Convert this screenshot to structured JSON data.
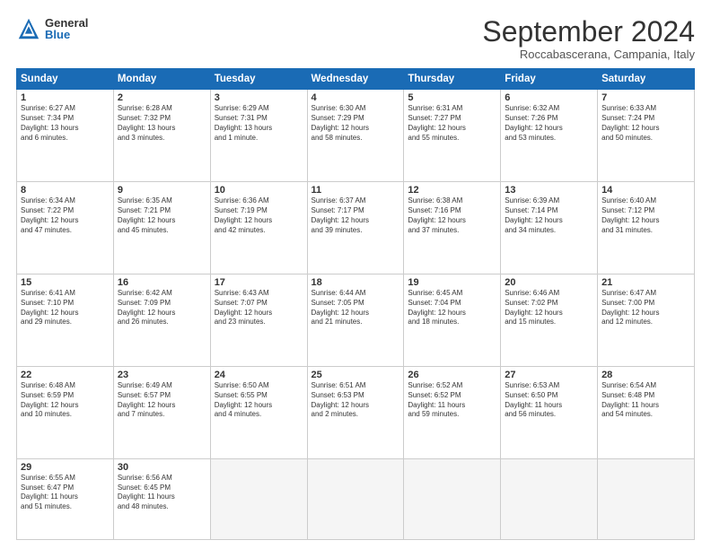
{
  "header": {
    "logo_general": "General",
    "logo_blue": "Blue",
    "month_title": "September 2024",
    "location": "Roccabascerana, Campania, Italy"
  },
  "days_of_week": [
    "Sunday",
    "Monday",
    "Tuesday",
    "Wednesday",
    "Thursday",
    "Friday",
    "Saturday"
  ],
  "weeks": [
    [
      {
        "num": "1",
        "info": "Sunrise: 6:27 AM\nSunset: 7:34 PM\nDaylight: 13 hours\nand 6 minutes."
      },
      {
        "num": "2",
        "info": "Sunrise: 6:28 AM\nSunset: 7:32 PM\nDaylight: 13 hours\nand 3 minutes."
      },
      {
        "num": "3",
        "info": "Sunrise: 6:29 AM\nSunset: 7:31 PM\nDaylight: 13 hours\nand 1 minute."
      },
      {
        "num": "4",
        "info": "Sunrise: 6:30 AM\nSunset: 7:29 PM\nDaylight: 12 hours\nand 58 minutes."
      },
      {
        "num": "5",
        "info": "Sunrise: 6:31 AM\nSunset: 7:27 PM\nDaylight: 12 hours\nand 55 minutes."
      },
      {
        "num": "6",
        "info": "Sunrise: 6:32 AM\nSunset: 7:26 PM\nDaylight: 12 hours\nand 53 minutes."
      },
      {
        "num": "7",
        "info": "Sunrise: 6:33 AM\nSunset: 7:24 PM\nDaylight: 12 hours\nand 50 minutes."
      }
    ],
    [
      {
        "num": "8",
        "info": "Sunrise: 6:34 AM\nSunset: 7:22 PM\nDaylight: 12 hours\nand 47 minutes."
      },
      {
        "num": "9",
        "info": "Sunrise: 6:35 AM\nSunset: 7:21 PM\nDaylight: 12 hours\nand 45 minutes."
      },
      {
        "num": "10",
        "info": "Sunrise: 6:36 AM\nSunset: 7:19 PM\nDaylight: 12 hours\nand 42 minutes."
      },
      {
        "num": "11",
        "info": "Sunrise: 6:37 AM\nSunset: 7:17 PM\nDaylight: 12 hours\nand 39 minutes."
      },
      {
        "num": "12",
        "info": "Sunrise: 6:38 AM\nSunset: 7:16 PM\nDaylight: 12 hours\nand 37 minutes."
      },
      {
        "num": "13",
        "info": "Sunrise: 6:39 AM\nSunset: 7:14 PM\nDaylight: 12 hours\nand 34 minutes."
      },
      {
        "num": "14",
        "info": "Sunrise: 6:40 AM\nSunset: 7:12 PM\nDaylight: 12 hours\nand 31 minutes."
      }
    ],
    [
      {
        "num": "15",
        "info": "Sunrise: 6:41 AM\nSunset: 7:10 PM\nDaylight: 12 hours\nand 29 minutes."
      },
      {
        "num": "16",
        "info": "Sunrise: 6:42 AM\nSunset: 7:09 PM\nDaylight: 12 hours\nand 26 minutes."
      },
      {
        "num": "17",
        "info": "Sunrise: 6:43 AM\nSunset: 7:07 PM\nDaylight: 12 hours\nand 23 minutes."
      },
      {
        "num": "18",
        "info": "Sunrise: 6:44 AM\nSunset: 7:05 PM\nDaylight: 12 hours\nand 21 minutes."
      },
      {
        "num": "19",
        "info": "Sunrise: 6:45 AM\nSunset: 7:04 PM\nDaylight: 12 hours\nand 18 minutes."
      },
      {
        "num": "20",
        "info": "Sunrise: 6:46 AM\nSunset: 7:02 PM\nDaylight: 12 hours\nand 15 minutes."
      },
      {
        "num": "21",
        "info": "Sunrise: 6:47 AM\nSunset: 7:00 PM\nDaylight: 12 hours\nand 12 minutes."
      }
    ],
    [
      {
        "num": "22",
        "info": "Sunrise: 6:48 AM\nSunset: 6:59 PM\nDaylight: 12 hours\nand 10 minutes."
      },
      {
        "num": "23",
        "info": "Sunrise: 6:49 AM\nSunset: 6:57 PM\nDaylight: 12 hours\nand 7 minutes."
      },
      {
        "num": "24",
        "info": "Sunrise: 6:50 AM\nSunset: 6:55 PM\nDaylight: 12 hours\nand 4 minutes."
      },
      {
        "num": "25",
        "info": "Sunrise: 6:51 AM\nSunset: 6:53 PM\nDaylight: 12 hours\nand 2 minutes."
      },
      {
        "num": "26",
        "info": "Sunrise: 6:52 AM\nSunset: 6:52 PM\nDaylight: 11 hours\nand 59 minutes."
      },
      {
        "num": "27",
        "info": "Sunrise: 6:53 AM\nSunset: 6:50 PM\nDaylight: 11 hours\nand 56 minutes."
      },
      {
        "num": "28",
        "info": "Sunrise: 6:54 AM\nSunset: 6:48 PM\nDaylight: 11 hours\nand 54 minutes."
      }
    ],
    [
      {
        "num": "29",
        "info": "Sunrise: 6:55 AM\nSunset: 6:47 PM\nDaylight: 11 hours\nand 51 minutes."
      },
      {
        "num": "30",
        "info": "Sunrise: 6:56 AM\nSunset: 6:45 PM\nDaylight: 11 hours\nand 48 minutes."
      },
      {
        "num": "",
        "info": ""
      },
      {
        "num": "",
        "info": ""
      },
      {
        "num": "",
        "info": ""
      },
      {
        "num": "",
        "info": ""
      },
      {
        "num": "",
        "info": ""
      }
    ]
  ]
}
